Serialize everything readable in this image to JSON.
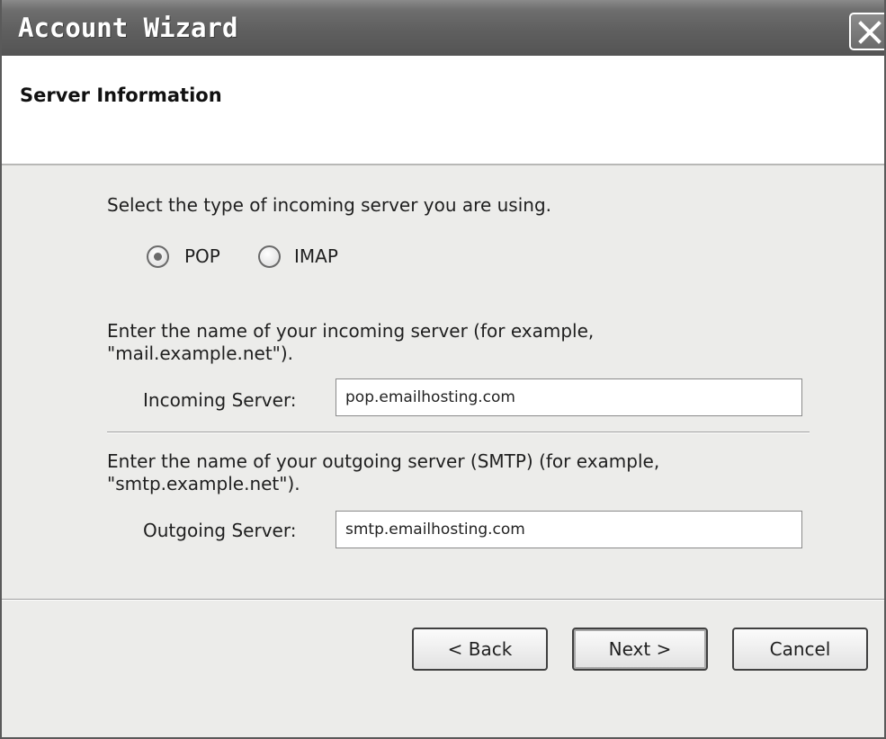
{
  "window": {
    "title": "Account Wizard",
    "close_icon": "close-icon"
  },
  "header": {
    "title": "Server Information"
  },
  "server_type": {
    "prompt": "Select the type of incoming server you are using.",
    "options": [
      {
        "label": "POP",
        "selected": true
      },
      {
        "label": "IMAP",
        "selected": false
      }
    ]
  },
  "incoming": {
    "description_line1": "Enter the name of your incoming server (for example,",
    "description_line2": "\"mail.example.net\").",
    "label": "Incoming Server:",
    "value": "pop.emailhosting.com"
  },
  "outgoing": {
    "description_line1": "Enter the name of your outgoing server (SMTP) (for example,",
    "description_line2": "\"smtp.example.net\").",
    "label": "Outgoing Server:",
    "value": "smtp.emailhosting.com"
  },
  "buttons": {
    "back": "< Back",
    "next": "Next >",
    "cancel": "Cancel"
  }
}
